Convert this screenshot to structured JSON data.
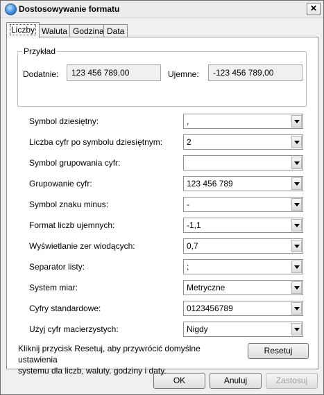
{
  "window": {
    "title": "Dostosowywanie formatu",
    "close_label": "✕"
  },
  "tabs": [
    {
      "label": "Liczby",
      "active": true
    },
    {
      "label": "Waluta",
      "active": false
    },
    {
      "label": "Godzina",
      "active": false
    },
    {
      "label": "Data",
      "active": false
    }
  ],
  "example": {
    "legend": "Przykład",
    "positive_label": "Dodatnie:",
    "positive_value": "123 456 789,00",
    "negative_label": "Ujemne:",
    "negative_value": "-123 456 789,00"
  },
  "settings": [
    {
      "label": "Symbol dziesiętny:",
      "value": ","
    },
    {
      "label": "Liczba cyfr po symbolu dziesiętnym:",
      "value": "2"
    },
    {
      "label": "Symbol grupowania cyfr:",
      "value": ""
    },
    {
      "label": "Grupowanie cyfr:",
      "value": "123 456 789"
    },
    {
      "label": "Symbol znaku minus:",
      "value": "-"
    },
    {
      "label": "Format liczb ujemnych:",
      "value": "-1,1"
    },
    {
      "label": "Wyświetlanie zer wiodących:",
      "value": "0,7"
    },
    {
      "label": "Separator listy:",
      "value": ";"
    },
    {
      "label": "System miar:",
      "value": "Metryczne"
    },
    {
      "label": "Cyfry standardowe:",
      "value": "0123456789"
    },
    {
      "label": "Użyj cyfr macierzystych:",
      "value": "Nigdy"
    }
  ],
  "reset": {
    "info_line1": "Kliknij przycisk Resetuj, aby przywrócić domyślne ustawienia",
    "info_line2": "systemu dla liczb, waluty, godziny i daty.",
    "button_label": "Resetuj"
  },
  "footer": {
    "ok_label": "OK",
    "cancel_label": "Anuluj",
    "apply_label": "Zastosuj"
  }
}
